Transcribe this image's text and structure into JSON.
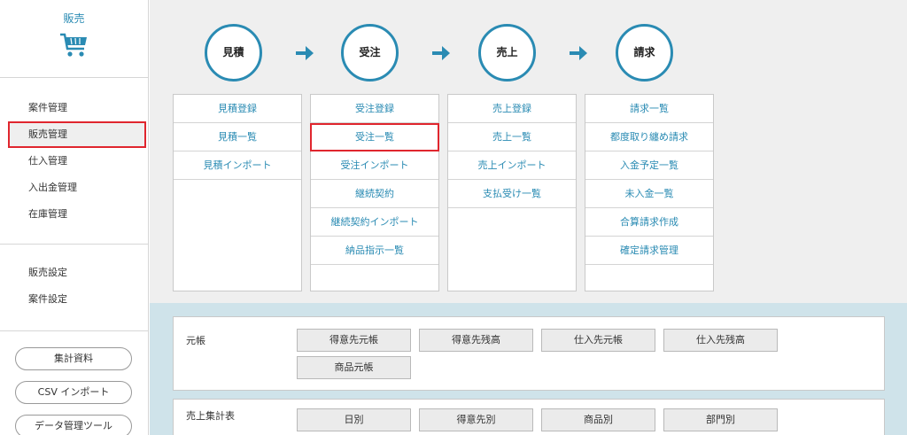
{
  "sidebar": {
    "title": "販売",
    "icon": "shopping-cart-icon",
    "group1": [
      "案件管理",
      "販売管理",
      "仕入管理",
      "入出金管理",
      "在庫管理"
    ],
    "group2": [
      "販売設定",
      "案件設定"
    ],
    "buttons": [
      "集計資料",
      "CSV インポート",
      "データ管理ツール"
    ],
    "active_item": "販売管理"
  },
  "flow": {
    "steps": [
      "見積",
      "受注",
      "売上",
      "請求"
    ],
    "arrow_icon": "arrow-right-icon",
    "accent_color": "#2a8bb3"
  },
  "columns": [
    {
      "items": [
        "見積登録",
        "見積一覧",
        "見積インポート"
      ]
    },
    {
      "items": [
        "受注登録",
        "受注一覧",
        "受注インポート",
        "継続契約",
        "継続契約インポート",
        "納品指示一覧"
      ]
    },
    {
      "items": [
        "売上登録",
        "売上一覧",
        "売上インポート",
        "支払受け一覧"
      ]
    },
    {
      "items": [
        "請求一覧",
        "都度取り纏め請求",
        "入金予定一覧",
        "未入金一覧",
        "合算請求作成",
        "確定請求管理"
      ]
    }
  ],
  "highlighted_item": "受注一覧",
  "highlight_color": "#e0262e",
  "panels": [
    {
      "label": "元帳",
      "buttons": [
        "得意先元帳",
        "得意先残高",
        "仕入先元帳",
        "仕入先残高",
        "商品元帳"
      ]
    },
    {
      "label": "売上集計表",
      "buttons": [
        "日別",
        "得意先別",
        "商品別",
        "部門別"
      ]
    }
  ]
}
